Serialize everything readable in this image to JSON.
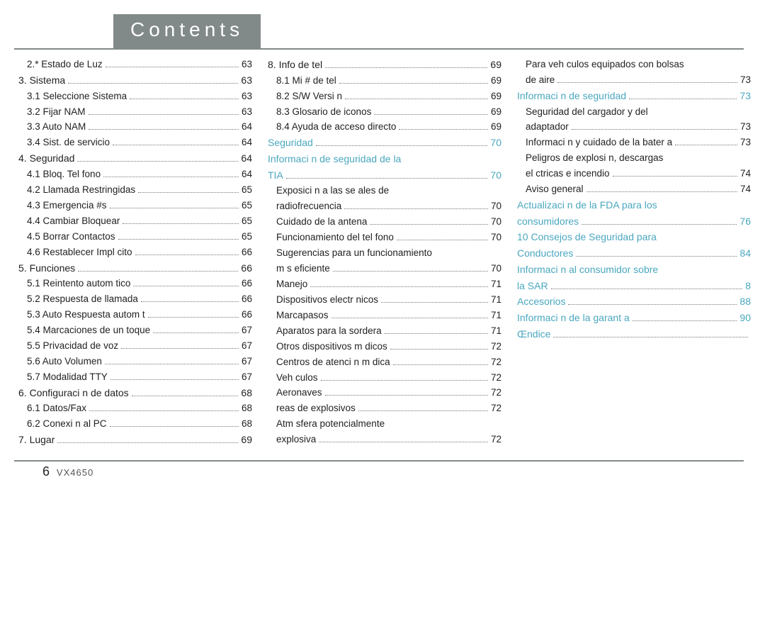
{
  "header": {
    "title": "Contents"
  },
  "footer": {
    "page": "6",
    "model": "VX4650"
  },
  "col1": [
    {
      "t": "2.* Estado de Luz",
      "p": "63",
      "cls": "lvl2"
    },
    {
      "t": "3. Sistema",
      "p": "63",
      "cls": "lvl1"
    },
    {
      "t": "3.1 Seleccione Sistema",
      "p": "63",
      "cls": "lvl2"
    },
    {
      "t": "3.2 Fijar NAM",
      "p": "63",
      "cls": "lvl2"
    },
    {
      "t": "3.3 Auto NAM",
      "p": "64",
      "cls": "lvl2"
    },
    {
      "t": "3.4 Sist. de servicio",
      "p": "64",
      "cls": "lvl2"
    },
    {
      "t": "4. Seguridad",
      "p": "64",
      "cls": "lvl1"
    },
    {
      "t": "4.1 Bloq. Tel fono",
      "p": "64",
      "cls": "lvl2"
    },
    {
      "t": "4.2 Llamada Restringidas",
      "p": "65",
      "cls": "lvl2"
    },
    {
      "t": "4.3 Emergencia #s",
      "p": "65",
      "cls": "lvl2"
    },
    {
      "t": "4.4 Cambiar Bloquear",
      "p": "65",
      "cls": "lvl2"
    },
    {
      "t": "4.5 Borrar Contactos",
      "p": "65",
      "cls": "lvl2"
    },
    {
      "t": "4.6 Restablecer Impl cito",
      "p": "66",
      "cls": "lvl2"
    },
    {
      "t": "5. Funciones",
      "p": "66",
      "cls": "lvl1"
    },
    {
      "t": "5.1 Reintento autom tico",
      "p": "66",
      "cls": "lvl2"
    },
    {
      "t": "5.2 Respuesta de llamada",
      "p": "66",
      "cls": "lvl2"
    },
    {
      "t": "5.3 Auto Respuesta autom t",
      "p": "66",
      "cls": "lvl2"
    },
    {
      "t": "5.4 Marcaciones de un toque",
      "p": "67",
      "cls": "lvl2"
    },
    {
      "t": "5.5 Privacidad de voz",
      "p": "67",
      "cls": "lvl2"
    },
    {
      "t": "5.6 Auto Volumen",
      "p": "67",
      "cls": "lvl2"
    },
    {
      "t": "5.7 Modalidad TTY",
      "p": "67",
      "cls": "lvl2"
    },
    {
      "t": "6. Configuraci n de datos",
      "p": "68",
      "cls": "lvl1"
    },
    {
      "t": "6.1 Datos/Fax",
      "p": "68",
      "cls": "lvl2"
    },
    {
      "t": "6.2 Conexi n al PC",
      "p": "68",
      "cls": "lvl2"
    },
    {
      "t": "7. Lugar",
      "p": "69",
      "cls": "lvl1"
    }
  ],
  "col2": [
    {
      "t": "8. Info de tel",
      "p": "69",
      "cls": "lvl1"
    },
    {
      "t": "8.1 Mi # de tel",
      "p": "69",
      "cls": "lvl2"
    },
    {
      "t": "8.2 S/W Versi n",
      "p": "69",
      "cls": "lvl2"
    },
    {
      "t": "8.3 Glosario de iconos",
      "p": "69",
      "cls": "lvl2"
    },
    {
      "t": "8.4 Ayuda de acceso directo",
      "p": "69",
      "cls": "lvl2"
    },
    {
      "t": "Seguridad",
      "p": "70",
      "cls": "lvl1 blue"
    },
    {
      "t": "Informaci n de seguridad de la",
      "cls": "lvl1 blue",
      "nolead": true
    },
    {
      "t": "TIA",
      "p": "70",
      "cls": "lvl1 blue"
    },
    {
      "t": "Exposici n a las se ales de",
      "cls": "lvl2",
      "nolead": true
    },
    {
      "t": "radiofrecuencia",
      "p": "70",
      "cls": "lvl2"
    },
    {
      "t": "Cuidado de la antena",
      "p": "70",
      "cls": "lvl2"
    },
    {
      "t": "Funcionamiento del tel fono",
      "p": "70",
      "cls": "lvl2"
    },
    {
      "t": "Sugerencias para un funcionamiento",
      "cls": "lvl2",
      "nolead": true
    },
    {
      "t": "m s eficiente",
      "p": "70",
      "cls": "lvl2"
    },
    {
      "t": "Manejo",
      "p": "71",
      "cls": "lvl2"
    },
    {
      "t": "Dispositivos electr nicos",
      "p": "71",
      "cls": "lvl2"
    },
    {
      "t": "Marcapasos",
      "p": "71",
      "cls": "lvl2"
    },
    {
      "t": "Aparatos para la sordera",
      "p": "71",
      "cls": "lvl2"
    },
    {
      "t": "Otros dispositivos m dicos",
      "p": "72",
      "cls": "lvl2"
    },
    {
      "t": "Centros de atenci n m dica",
      "p": "72",
      "cls": "lvl2"
    },
    {
      "t": "Veh culos",
      "p": "72",
      "cls": "lvl2"
    },
    {
      "t": "Aeronaves",
      "p": "72",
      "cls": "lvl2"
    },
    {
      "t": " reas de explosivos",
      "p": "72",
      "cls": "lvl2"
    },
    {
      "t": "Atm sfera potencialmente",
      "cls": "lvl2",
      "nolead": true
    },
    {
      "t": "explosiva",
      "p": "72",
      "cls": "lvl2"
    }
  ],
  "col3": [
    {
      "t": "Para veh culos equipados con bolsas",
      "cls": "lvl2",
      "nolead": true
    },
    {
      "t": "de aire",
      "p": "73",
      "cls": "lvl2"
    },
    {
      "t": "Informaci n de seguridad",
      "p": "73",
      "cls": "lvl1 blue"
    },
    {
      "t": "Seguridad del cargador y del",
      "cls": "lvl2",
      "nolead": true
    },
    {
      "t": "adaptador",
      "p": "73",
      "cls": "lvl2"
    },
    {
      "t": "Informaci n y cuidado de la bater a",
      "p": "73",
      "cls": "lvl2"
    },
    {
      "t": "Peligros de explosi n, descargas",
      "cls": "lvl2",
      "nolead": true
    },
    {
      "t": "el ctricas e incendio",
      "p": "74",
      "cls": "lvl2"
    },
    {
      "t": "Aviso general",
      "p": "74",
      "cls": "lvl2"
    },
    {
      "t": "Actualizaci n de la FDA para los",
      "cls": "lvl1 blue",
      "nolead": true
    },
    {
      "t": "consumidores",
      "p": "76",
      "cls": "lvl1 blue"
    },
    {
      "t": "10 Consejos de Seguridad para",
      "cls": "lvl1 blue",
      "nolead": true
    },
    {
      "t": "Conductores",
      "p": "84",
      "cls": "lvl1 blue"
    },
    {
      "t": "Informaci n al consumidor sobre",
      "cls": "lvl1 blue",
      "nolead": true
    },
    {
      "t": "la SAR",
      "p": "8",
      "cls": "lvl1 blue"
    },
    {
      "t": "Accesorios",
      "p": "88",
      "cls": "lvl1 blue"
    },
    {
      "t": "Informaci n de la garant a",
      "p": "90",
      "cls": "lvl1 blue"
    },
    {
      "t": "Œndice",
      "p": "",
      "cls": "lvl1 blue"
    }
  ]
}
